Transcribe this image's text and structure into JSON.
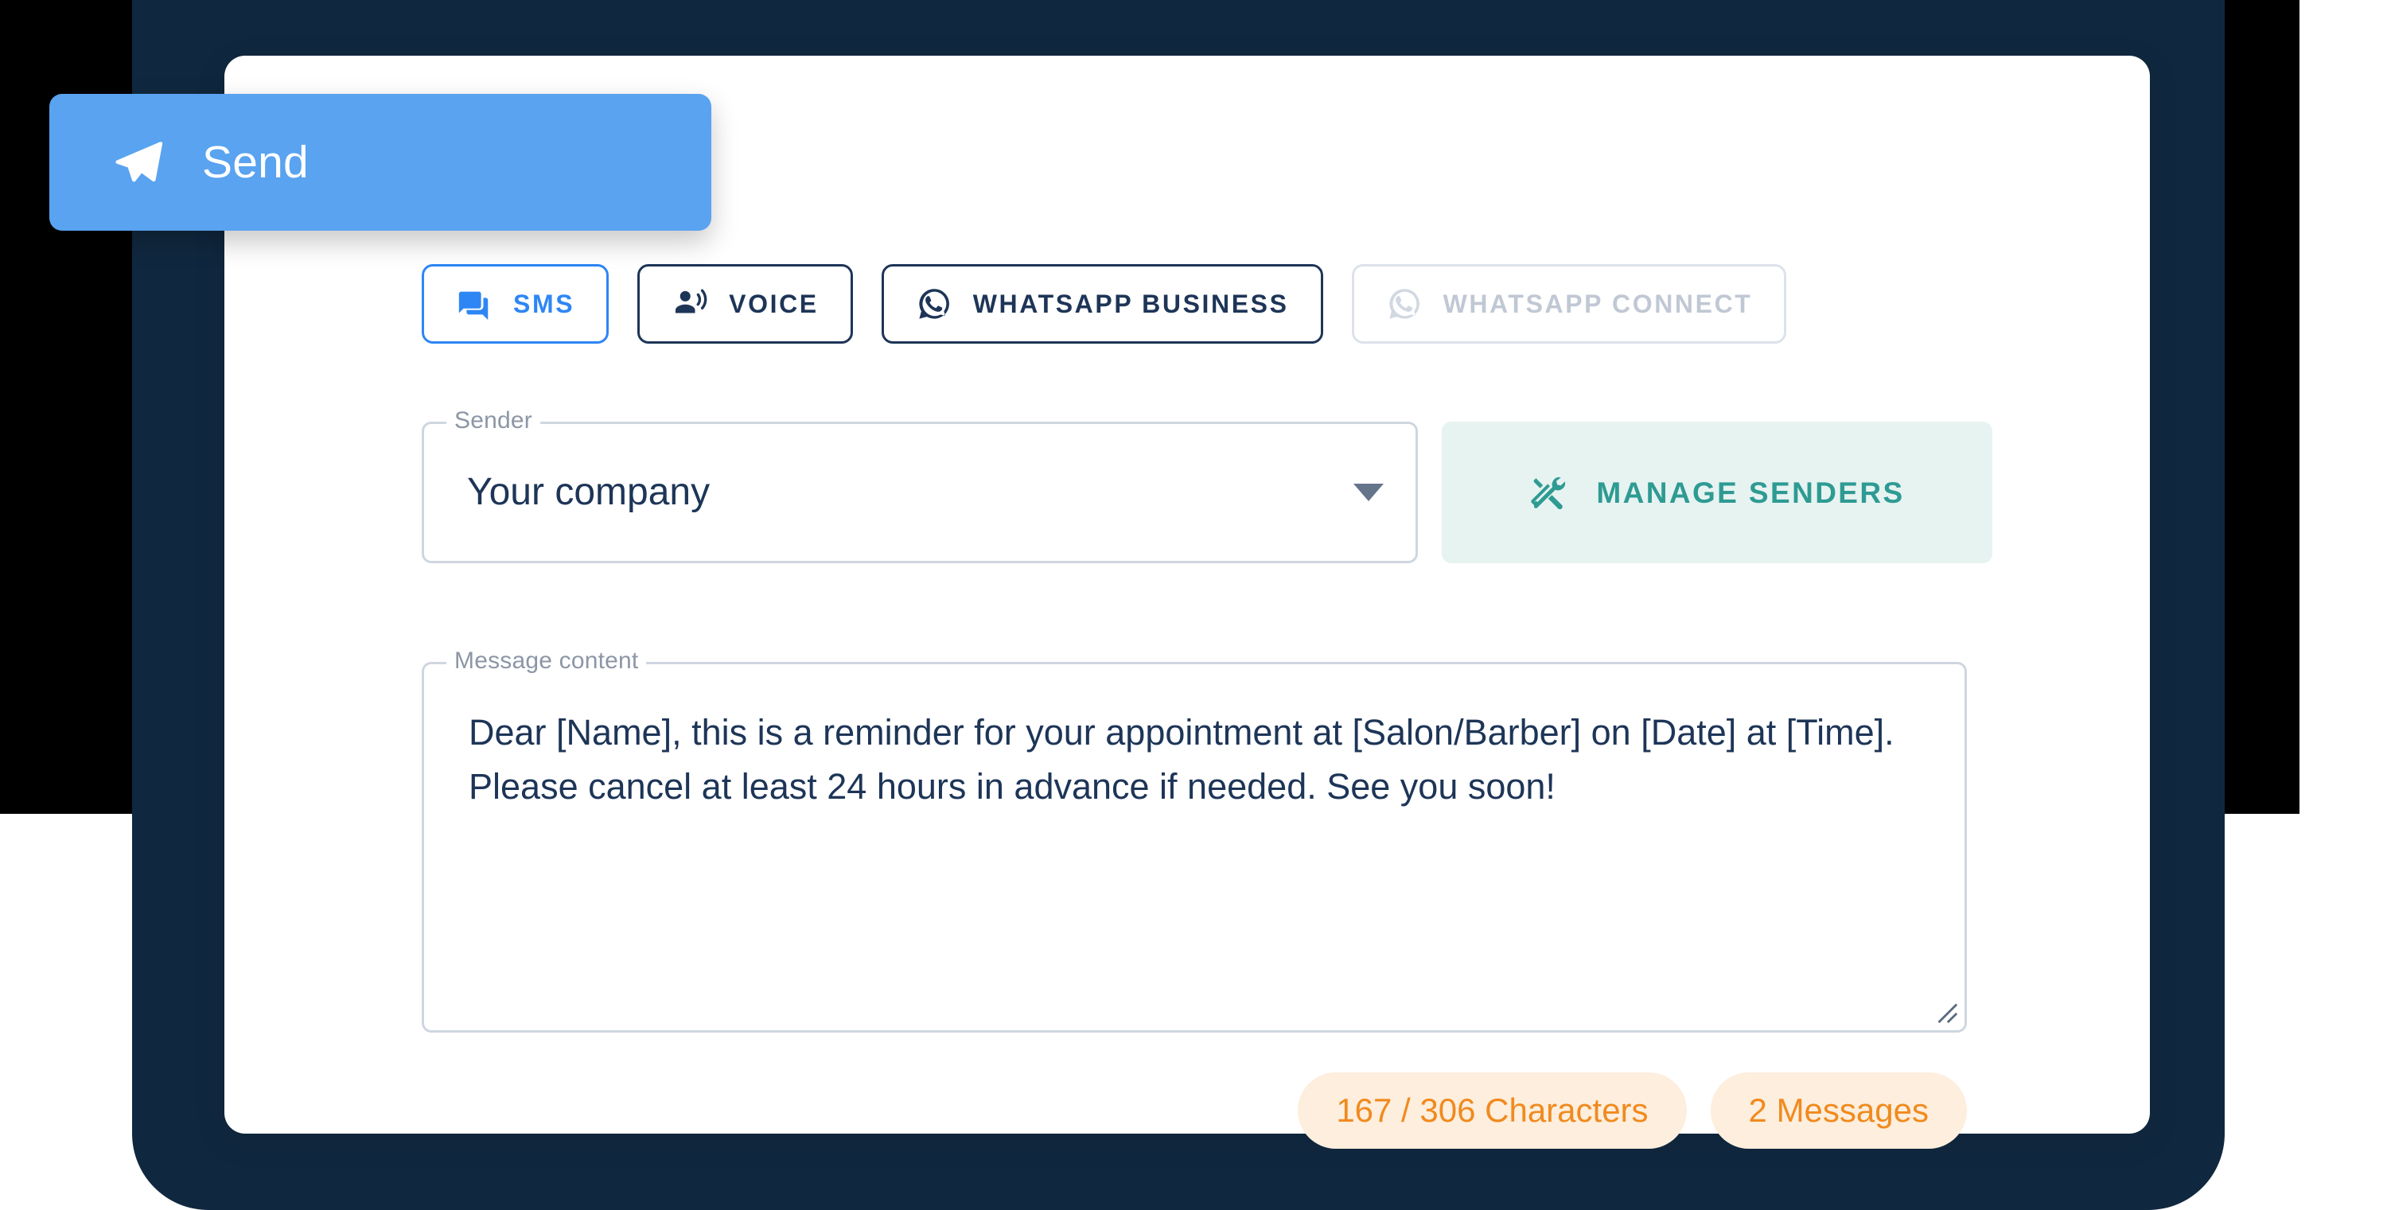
{
  "colors": {
    "backdrop_black": "#000000",
    "panel_navy": "#10283f",
    "card_white": "#ffffff",
    "accent_blue": "#2e86f5",
    "send_blue": "#59a3f0",
    "text_navy": "#1d3557",
    "teal": "#2e9b93",
    "teal_bg": "#e7f3f1",
    "badge_orange": "#f08a1e",
    "badge_bg": "#fdeedd",
    "disabled_grey": "#c0c8d4",
    "field_border": "#cfd6e0",
    "label_grey": "#8c96a6"
  },
  "send_button": {
    "label": "Send",
    "icon": "send-paper-plane-icon"
  },
  "channel_tabs": [
    {
      "label": "SMS",
      "icon": "forum-chat-bubbles-icon",
      "state": "active"
    },
    {
      "label": "VOICE",
      "icon": "record-voice-over-icon",
      "state": "default"
    },
    {
      "label": "WHATSAPP BUSINESS",
      "icon": "whatsapp-icon",
      "state": "default"
    },
    {
      "label": "WHATSAPP CONNECT",
      "icon": "whatsapp-icon",
      "state": "disabled"
    }
  ],
  "sender": {
    "legend": "Sender",
    "value": "Your company",
    "caret_icon": "chevron-down-icon"
  },
  "manage_senders": {
    "label": "MANAGE SENDERS",
    "icon": "handyman-tools-icon"
  },
  "message": {
    "legend": "Message content",
    "value": "Dear [Name], this is a reminder for your appointment at [Salon/Barber] on [Date] at [Time]. Please cancel at least 24 hours in advance if needed. See you soon!",
    "placeholder": "Message content"
  },
  "badges": [
    {
      "label": "167 / 306 Characters",
      "name": "character-count-badge"
    },
    {
      "label": "2 Messages",
      "name": "message-count-badge"
    }
  ]
}
